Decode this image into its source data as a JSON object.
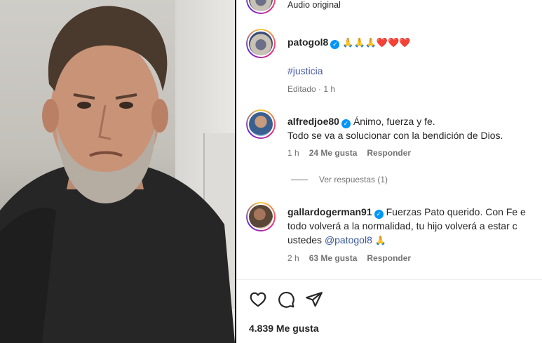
{
  "post": {
    "audio_label": "Audio original",
    "author": "patogol8",
    "caption_emojis": "🙏🙏🙏❤️❤️❤️",
    "hashtag": "#justicia",
    "edited_meta": "Editado · 1 h"
  },
  "comments": [
    {
      "user": "alfredjoe80",
      "text_line1": "Ánimo, fuerza y fe.",
      "text_line2": "Todo se va a solucionar con la bendición de Dios.",
      "time": "1 h",
      "likes": "24 Me gusta",
      "reply": "Responder"
    },
    {
      "user": "gallardogerman91",
      "text_line1": "Fuerzas Pato querido. Con Fe e",
      "text_line2": "todo volverá a la normalidad, tu hijo volverá a estar c",
      "text_line3_prefix": "ustedes ",
      "mention": "@patogol8",
      "text_line3_emoji": "🙏",
      "time": "2 h",
      "likes": "63 Me gusta",
      "reply": "Responder"
    }
  ],
  "view_replies": "Ver respuestas (1)",
  "likes_total": "4.839 Me gusta",
  "colors": {
    "verified": "#0095f6",
    "hashtag": "#4a5fa8",
    "mention": "#385898",
    "muted": "#737373"
  },
  "icons": [
    "heart-icon",
    "comment-icon",
    "share-icon",
    "verified-icon"
  ]
}
